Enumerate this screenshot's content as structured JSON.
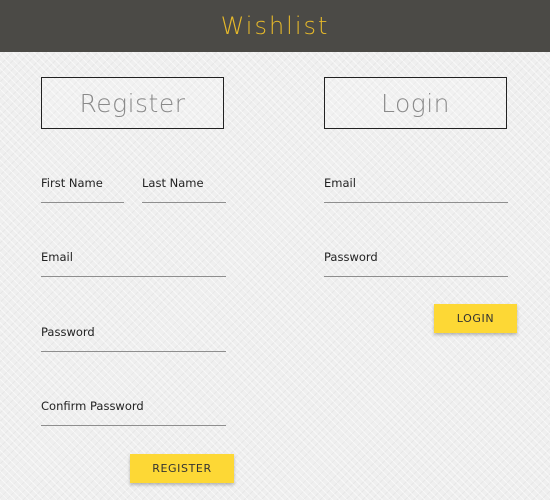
{
  "header": {
    "title": "Wishlist"
  },
  "register": {
    "heading": "Register",
    "fields": {
      "first_name": {
        "label": "First Name",
        "value": ""
      },
      "last_name": {
        "label": "Last Name",
        "value": ""
      },
      "email": {
        "label": "Email",
        "value": ""
      },
      "password": {
        "label": "Password",
        "value": ""
      },
      "confirm_password": {
        "label": "Confirm Password",
        "value": ""
      }
    },
    "button_label": "REGISTER"
  },
  "login": {
    "heading": "Login",
    "fields": {
      "email": {
        "label": "Email",
        "value": ""
      },
      "password": {
        "label": "Password",
        "value": ""
      }
    },
    "button_label": "LOGIN"
  },
  "colors": {
    "header_bg": "#4b4a46",
    "title": "#e6b92a",
    "button": "#fdd835"
  }
}
